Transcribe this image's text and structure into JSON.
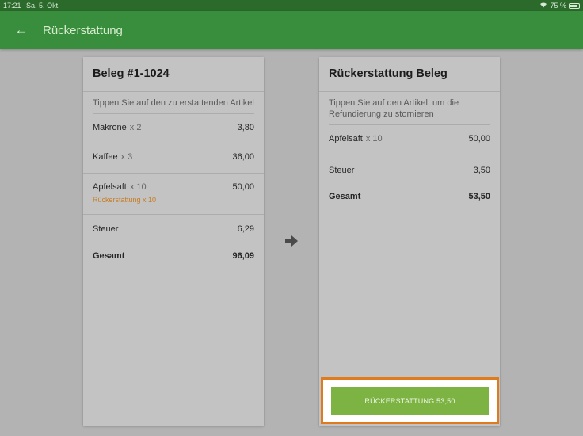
{
  "status_bar": {
    "time": "17:21",
    "date": "Sa. 5. Okt.",
    "battery": "75 %"
  },
  "app_bar": {
    "title": "Rückerstattung"
  },
  "receipt": {
    "title": "Beleg #1-1024",
    "hint": "Tippen Sie auf den zu erstattenden Artikel",
    "items": [
      {
        "name": "Makrone",
        "qty": "x 2",
        "amount": "3,80"
      },
      {
        "name": "Kaffee",
        "qty": "x 3",
        "amount": "36,00"
      },
      {
        "name": "Apfelsaft",
        "qty": "x 10",
        "amount": "50,00",
        "note": "Rückerstattung x 10"
      }
    ],
    "tax_label": "Steuer",
    "tax": "6,29",
    "total_label": "Gesamt",
    "total": "96,09"
  },
  "refund_receipt": {
    "title": "Rückerstattung Beleg",
    "hint": "Tippen Sie auf den Artikel, um die Refundierung zu stornieren",
    "items": [
      {
        "name": "Apfelsaft",
        "qty": "x 10",
        "amount": "50,00"
      }
    ],
    "tax_label": "Steuer",
    "tax": "3,50",
    "total_label": "Gesamt",
    "total": "53,50"
  },
  "refund_button": {
    "label": "RÜCKERSTATTUNG 53,50"
  },
  "colors": {
    "appbar": "#388e3c",
    "statusbar": "#2b6a2b",
    "button": "#7cb342",
    "highlight": "#e07b1d",
    "refund_note": "#c77d22"
  }
}
